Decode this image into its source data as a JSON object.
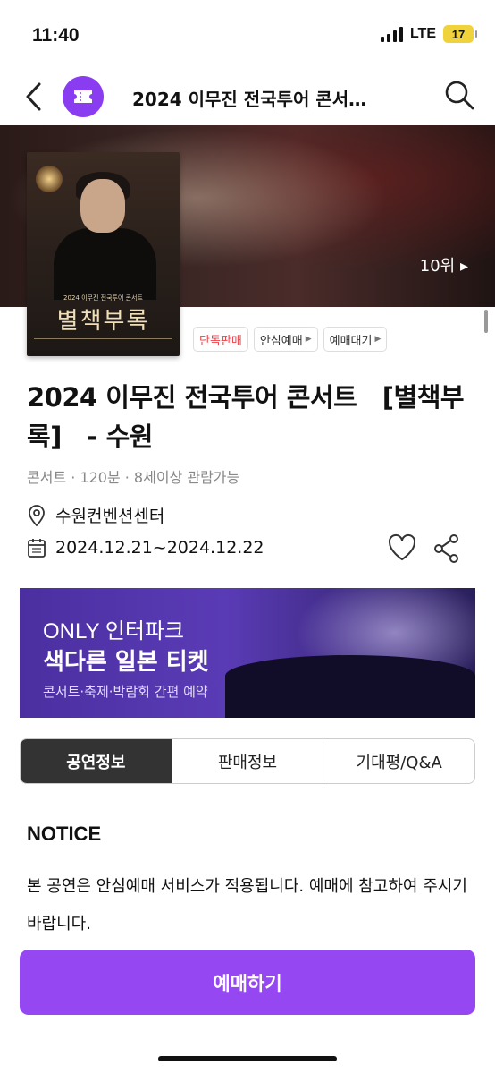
{
  "status": {
    "time": "11:40",
    "network": "LTE",
    "battery": "17"
  },
  "nav": {
    "title": "2024 이무진 전국투어 콘서…"
  },
  "hero": {
    "rank": "10위 ▸"
  },
  "poster": {
    "subtitle": "2024 이무진 전국투어 콘서트",
    "title": "별책부록"
  },
  "tags": [
    {
      "label": "단독판매"
    },
    {
      "label": "안심예매"
    },
    {
      "label": "예매대기"
    }
  ],
  "event": {
    "title": "2024 이무진 전국투어 콘서트　[별책부록]　- 수원",
    "meta": "콘서트 · 120분 · 8세이상 관람가능",
    "venue": "수원컨벤션센터",
    "dates": "2024.12.21~2024.12.22"
  },
  "banner": {
    "line1": "ONLY 인터파크",
    "line2": "색다른 일본 티켓",
    "line3": "콘서트·축제·박람회 간편 예약"
  },
  "tabs": [
    "공연정보",
    "판매정보",
    "기대평/Q&A"
  ],
  "notice": {
    "heading": "NOTICE",
    "body": "본 공연은 안심예매 서비스가 적용됩니다. 예매에 참고하여 주시기 바랍니다."
  },
  "cta": {
    "label": "예매하기"
  },
  "colors": {
    "brand": "#9547f2",
    "tag_red": "#e8434a"
  }
}
